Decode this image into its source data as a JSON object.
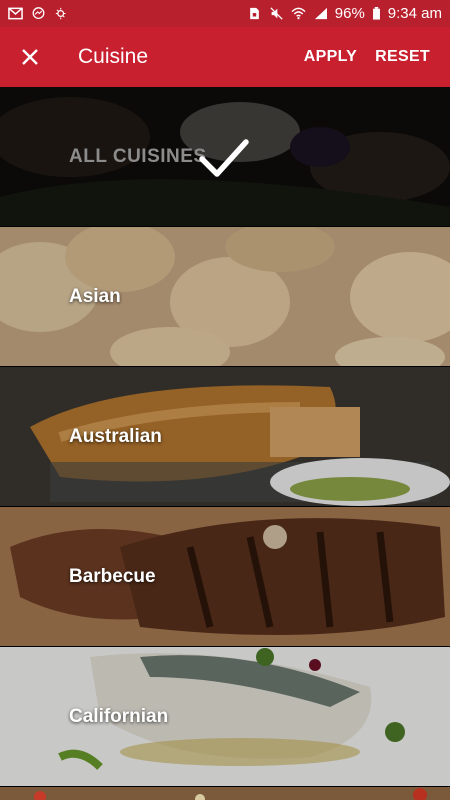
{
  "status_bar": {
    "battery": "96%",
    "time": "9:34 am",
    "left_icons": [
      "mail-icon",
      "messenger-icon",
      "weather-icon"
    ],
    "right_icons": [
      "sim-icon",
      "mute-icon",
      "wifi-icon",
      "signal-icon",
      "battery-icon"
    ]
  },
  "app_bar": {
    "title": "Cuisine",
    "apply_label": "APPLY",
    "reset_label": "RESET",
    "background": "#c8202f",
    "close_icon": "close-icon"
  },
  "cuisines": [
    {
      "label": "ALL CUISINES",
      "selected": true
    },
    {
      "label": "Asian",
      "selected": false
    },
    {
      "label": "Australian",
      "selected": false
    },
    {
      "label": "Barbecue",
      "selected": false
    },
    {
      "label": "Californian",
      "selected": false
    }
  ]
}
